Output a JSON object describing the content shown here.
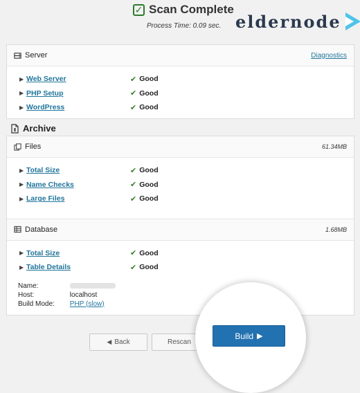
{
  "header": {
    "title": "Scan Complete",
    "process_time": "Process Time: 0.09 sec."
  },
  "logo": {
    "text": "eldernode"
  },
  "server": {
    "title": "Server",
    "link": "Diagnostics",
    "items": [
      {
        "label": "Web Server",
        "status": "Good"
      },
      {
        "label": "PHP Setup",
        "status": "Good"
      },
      {
        "label": "WordPress",
        "status": "Good"
      }
    ]
  },
  "archive": {
    "title": "Archive",
    "files": {
      "title": "Files",
      "size": "61.34MB",
      "items": [
        {
          "label": "Total Size",
          "status": "Good"
        },
        {
          "label": "Name Checks",
          "status": "Good"
        },
        {
          "label": "Large Files",
          "status": "Good"
        }
      ]
    },
    "database": {
      "title": "Database",
      "size": "1.68MB",
      "items": [
        {
          "label": "Total Size",
          "status": "Good"
        },
        {
          "label": "Table Details",
          "status": "Good"
        }
      ],
      "info": {
        "name_label": "Name:",
        "host_label": "Host:",
        "host_value": "localhost",
        "build_mode_label": "Build Mode:",
        "build_mode_value": "PHP (slow)"
      }
    }
  },
  "buttons": {
    "back": "Back",
    "rescan": "Rescan",
    "build": "Build"
  },
  "colors": {
    "link": "#21759b",
    "good": "#3a7d2c",
    "primary": "#2271b1"
  }
}
